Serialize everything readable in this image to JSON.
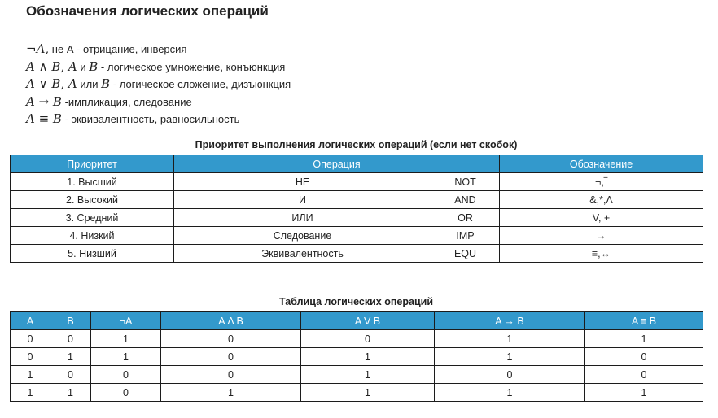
{
  "title": "Обозначения логических операций",
  "definitions": [
    {
      "formula": "¬A,",
      "text": "не А - отрицание, инверсия"
    },
    {
      "formula": "A ∧ B, A",
      "mid": "и",
      "formula2": "B",
      "text": "- логическое умножение, конъюнкция"
    },
    {
      "formula": "A ∨ B, A",
      "mid": "или",
      "formula2": "B",
      "text": "- логическое сложение, дизъюнкция"
    },
    {
      "formula": "A → B",
      "text": "-импликация, следование"
    },
    {
      "formula": "A ≡ B",
      "text": "- эквивалентность, равносильность"
    }
  ],
  "priority_table": {
    "caption": "Приоритет выполнения логических операций (если нет скобок)",
    "headers": [
      "Приоритет",
      "Операция",
      "Обозначение"
    ],
    "rows": [
      [
        "1. Высший",
        "НЕ",
        "NOT",
        "¬,‾"
      ],
      [
        "2. Высокий",
        "И",
        "AND",
        "&,*,Λ"
      ],
      [
        "3. Средний",
        "ИЛИ",
        "OR",
        "V, +"
      ],
      [
        "4. Низкий",
        "Следование",
        "IMP",
        "→"
      ],
      [
        "5. Низший",
        "Эквивалентность",
        "EQU",
        "≡,↔"
      ]
    ]
  },
  "truth_table": {
    "caption": "Таблица логических операций",
    "headers": [
      "A",
      "B",
      "¬A",
      "A Λ B",
      "A V B",
      "A → B",
      "A ≡ B"
    ],
    "rows": [
      [
        "0",
        "0",
        "1",
        "0",
        "0",
        "1",
        "1"
      ],
      [
        "0",
        "1",
        "1",
        "0",
        "1",
        "1",
        "0"
      ],
      [
        "1",
        "0",
        "0",
        "0",
        "1",
        "0",
        "0"
      ],
      [
        "1",
        "1",
        "0",
        "1",
        "1",
        "1",
        "1"
      ]
    ]
  }
}
